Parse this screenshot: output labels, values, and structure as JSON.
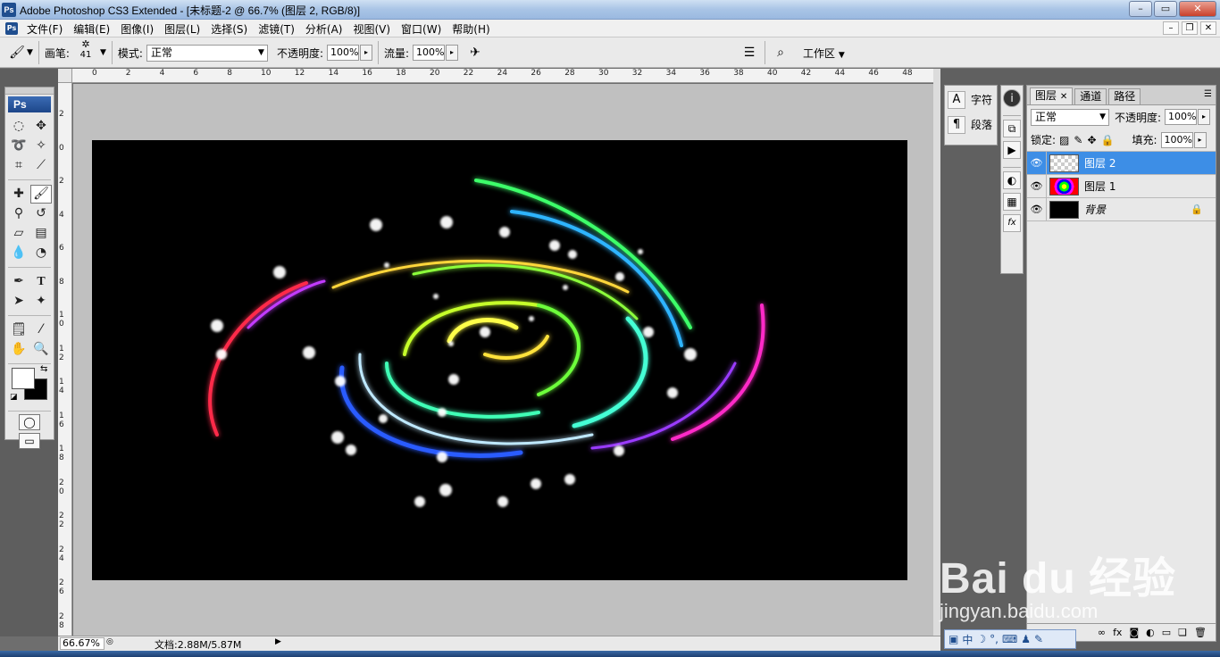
{
  "window": {
    "app_icon": "Ps",
    "title": "Adobe Photoshop CS3 Extended - [未标题-2 @ 66.7% (图层 2, RGB/8)]",
    "controls": [
      "minimize-icon",
      "maximize-icon",
      "close-icon"
    ]
  },
  "menu": {
    "items": [
      "文件(F)",
      "编辑(E)",
      "图像(I)",
      "图层(L)",
      "选择(S)",
      "滤镜(T)",
      "分析(A)",
      "视图(V)",
      "窗口(W)",
      "帮助(H)"
    ]
  },
  "options": {
    "brush_label": "画笔:",
    "brush_size": "41",
    "mode_label": "模式:",
    "mode_value": "正常",
    "opacity_label": "不透明度:",
    "opacity_value": "100%",
    "flow_label": "流量:",
    "flow_value": "100%",
    "workspace_label": "工作区"
  },
  "toolbox": {
    "logo": "Ps",
    "tools": [
      "marquee",
      "move",
      "lasso",
      "magic-wand",
      "crop",
      "slice",
      "healing",
      "brush",
      "stamp",
      "history-brush",
      "eraser",
      "gradient",
      "blur",
      "dodge",
      "pen",
      "type",
      "path-select",
      "shape",
      "notes",
      "eyedropper",
      "hand",
      "zoom"
    ],
    "active_tool": "brush",
    "foreground_color": "#ffffff",
    "background_color": "#000000"
  },
  "rulers": {
    "h_labels": [
      "0",
      "2",
      "4",
      "6",
      "8",
      "10",
      "12",
      "14",
      "16",
      "18",
      "20",
      "22",
      "24",
      "26",
      "28",
      "30",
      "32",
      "34",
      "36",
      "38",
      "40",
      "42",
      "44",
      "46",
      "48"
    ],
    "v_labels": [
      "2",
      "0",
      "2",
      "4",
      "6",
      "8",
      "1 0",
      "1 2",
      "1 4",
      "1 6",
      "1 8",
      "2 0",
      "2 2",
      "2 4",
      "2 6",
      "2 8"
    ]
  },
  "status": {
    "zoom": "66.67%",
    "doc": "文档:2.88M/5.87M"
  },
  "char_panel": {
    "items": [
      {
        "icon": "A",
        "label": "字符"
      },
      {
        "icon": "¶",
        "label": "段落"
      }
    ]
  },
  "layers_panel": {
    "tabs": [
      "图层",
      "通道",
      "路径"
    ],
    "blend_mode": "正常",
    "opacity_label": "不透明度:",
    "opacity_value": "100%",
    "lock_label": "锁定:",
    "fill_label": "填充:",
    "fill_value": "100%",
    "layers": [
      {
        "name": "图层 2",
        "selected": true,
        "thumb": "checker"
      },
      {
        "name": "图层 1",
        "selected": false,
        "thumb": "spectrum"
      },
      {
        "name": "背景",
        "selected": false,
        "thumb": "bg",
        "locked": true
      }
    ]
  },
  "ime": {
    "label": "中"
  },
  "watermark": {
    "brand": "Bai du 经验",
    "url": "jingyan.baidu.com"
  },
  "colors": {
    "accent": "#3d8ee6",
    "canvas": "#000000",
    "pasteboard": "#c0c0c0"
  }
}
